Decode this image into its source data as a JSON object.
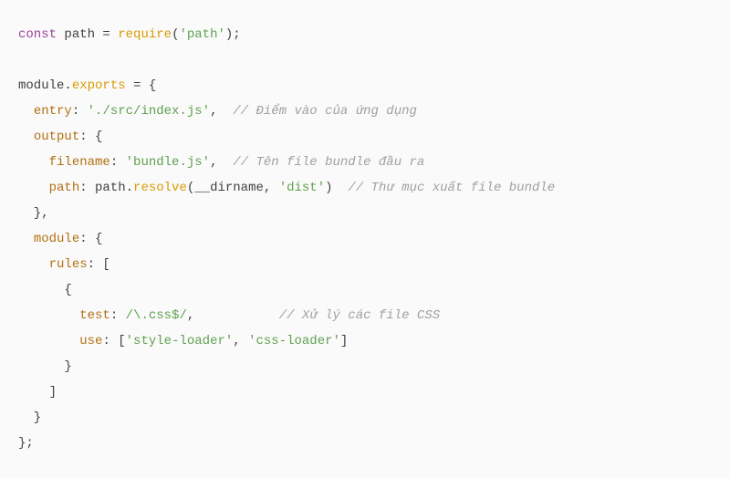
{
  "code": {
    "l1": {
      "kw_const": "const",
      "id_path": "path",
      "op_eq": " = ",
      "fn_require": "require",
      "paren_open": "(",
      "str_path": "'path'",
      "paren_close": ")",
      "semi": ";"
    },
    "l3": {
      "id_module": "module",
      "dot": ".",
      "id_exports": "exports",
      "op_eq": " = {"
    },
    "l4": {
      "indent": "  ",
      "key_entry": "entry",
      "colon": ": ",
      "str_entry": "'./src/index.js'",
      "comma": ",  ",
      "comment": "// Điểm vào của ứng dụng"
    },
    "l5": {
      "indent": "  ",
      "key_output": "output",
      "rest": ": {"
    },
    "l6": {
      "indent": "    ",
      "key_filename": "filename",
      "colon": ": ",
      "str_filename": "'bundle.js'",
      "comma": ",  ",
      "comment": "// Tên file bundle đầu ra"
    },
    "l7": {
      "indent": "    ",
      "key_path": "path",
      "colon": ": ",
      "id_path": "path",
      "dot": ".",
      "fn_resolve": "resolve",
      "paren_open": "(",
      "id_dirname": "__dirname",
      "comma_arg": ", ",
      "str_dist": "'dist'",
      "paren_close": ")",
      "spaces": "  ",
      "comment": "// Thư mục xuất file bundle"
    },
    "l8": {
      "text": "  },"
    },
    "l9": {
      "indent": "  ",
      "key_module": "module",
      "rest": ": {"
    },
    "l10": {
      "indent": "    ",
      "key_rules": "rules",
      "rest": ": ["
    },
    "l11": {
      "text": "      {"
    },
    "l12": {
      "indent": "        ",
      "key_test": "test",
      "colon": ": ",
      "regex": "/\\.css$/",
      "comma": ",",
      "spaces": "           ",
      "comment": "// Xử lý các file CSS"
    },
    "l13": {
      "indent": "        ",
      "key_use": "use",
      "colon": ": [",
      "str_style": "'style-loader'",
      "comma_arr": ", ",
      "str_css": "'css-loader'",
      "close": "]"
    },
    "l14": {
      "text": "      }"
    },
    "l15": {
      "text": "    ]"
    },
    "l16": {
      "text": "  }"
    },
    "l17": {
      "text": "};"
    }
  }
}
